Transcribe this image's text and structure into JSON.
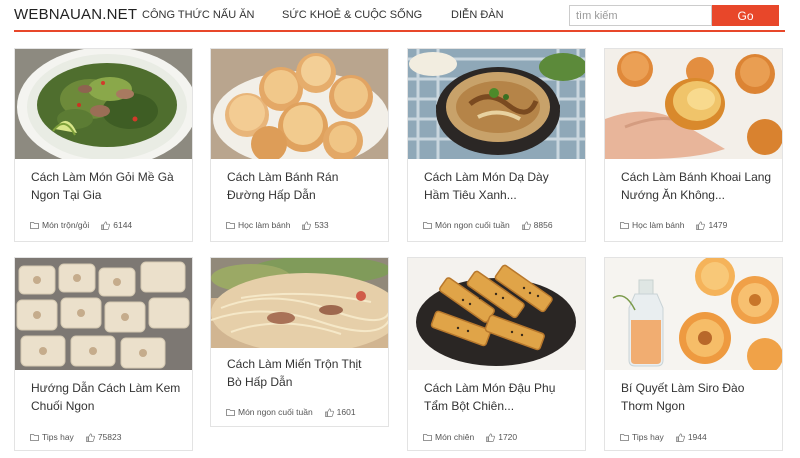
{
  "site": {
    "logo": "WEBNAUAN.NET"
  },
  "nav": [
    {
      "label": "CÔNG THỨC NẤU ĂN"
    },
    {
      "label": "SỨC KHOẺ & CUỘC SỐNG"
    },
    {
      "label": "DIỄN ĐÀN"
    }
  ],
  "search": {
    "placeholder": "tìm kiếm",
    "button_label": "Go"
  },
  "colors": {
    "accent": "#e8472a"
  },
  "cards": [
    {
      "title": "Cách Làm Món Gỏi Mề Gà Ngon Tại Gia",
      "category": "Món trộn/gỏi",
      "likes": "6144",
      "image": "chicken-gizzard-salad"
    },
    {
      "title": "Cách Làm Bánh Rán Đường Hấp Dẫn",
      "category": "Học làm bánh",
      "likes": "533",
      "image": "fried-sugar-dough-balls"
    },
    {
      "title": "Cách Làm Món Dạ Dày Hầm Tiêu Xanh...",
      "category": "Món ngon cuối tuần",
      "likes": "8856",
      "image": "stewed-tripe-pot"
    },
    {
      "title": "Cách Làm Bánh Khoai Lang Nướng Ăn Không...",
      "category": "Học làm bánh",
      "likes": "1479",
      "image": "baked-sweet-potato-buns"
    },
    {
      "title": "Hướng Dẫn Cách Làm Kem Chuối Ngon",
      "category": "Tips hay",
      "likes": "75823",
      "image": "banana-ice-cream-bars"
    },
    {
      "title": "Cách Làm Miến Trộn Thịt Bò Hấp Dẫn",
      "category": "Món ngon cuối tuần",
      "likes": "1601",
      "image": "beef-glass-noodle-salad"
    },
    {
      "title": "Cách Làm Món Đậu Phụ Tẩm Bột Chiên...",
      "category": "Món chiên",
      "likes": "1720",
      "image": "battered-fried-tofu"
    },
    {
      "title": "Bí Quyết Làm Siro Đào Thơm Ngon",
      "category": "Tips hay",
      "likes": "1944",
      "image": "peach-syrup"
    }
  ],
  "icons": {
    "category": "folder-icon",
    "likes": "thumbs-up-icon"
  }
}
